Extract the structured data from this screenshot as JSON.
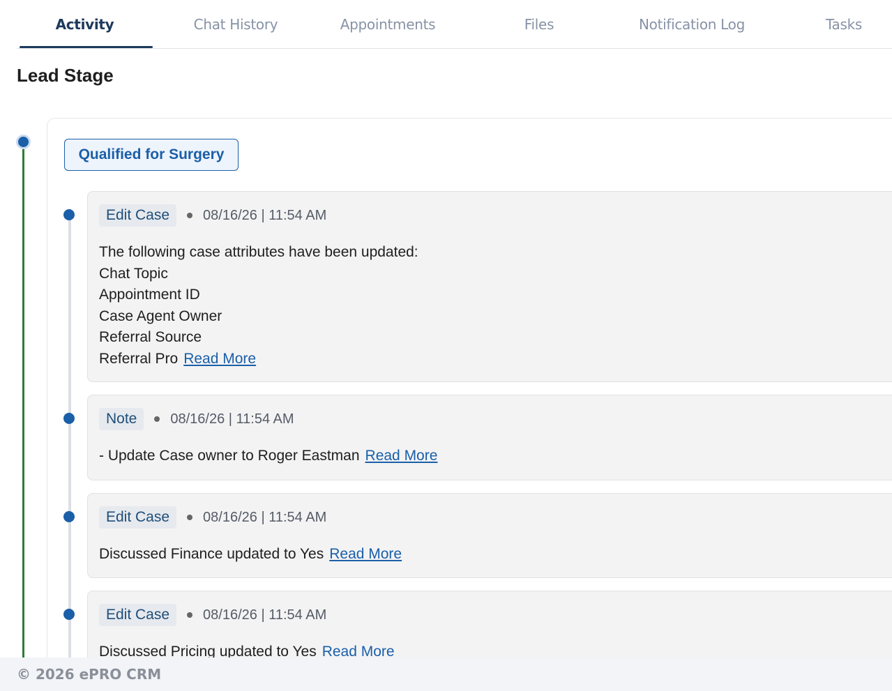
{
  "tabs": [
    "Activity",
    "Chat History",
    "Appointments",
    "Files",
    "Notification Log",
    "Tasks"
  ],
  "section_title": "Lead Stage",
  "stage": "Qualified for Surgery",
  "activities": [
    {
      "type": "Edit Case",
      "date": "08/16/26 | 11:54 AM",
      "lines": [
        "The following case attributes have been updated:",
        "Chat Topic",
        "Appointment ID",
        "Case Agent Owner",
        "Referral Source",
        "Referral Pro"
      ],
      "read_more": "Read More"
    },
    {
      "type": "Note",
      "date": "08/16/26 | 11:54 AM",
      "lines": [
        "- Update Case owner to Roger Eastman"
      ],
      "read_more": "Read More"
    },
    {
      "type": "Edit Case",
      "date": "08/16/26 | 11:54 AM",
      "lines": [
        "Discussed Finance updated to Yes"
      ],
      "read_more": "Read More"
    },
    {
      "type": "Edit Case",
      "date": "08/16/26 | 11:54 AM",
      "lines": [
        "Discussed Pricing updated to Yes"
      ],
      "read_more": "Read More"
    }
  ],
  "footer": "© 2026 ePRO CRM",
  "colors": {
    "accent": "#1a5fa8",
    "timeline": "#2e7d32",
    "tab_active": "#1d3a5c"
  }
}
